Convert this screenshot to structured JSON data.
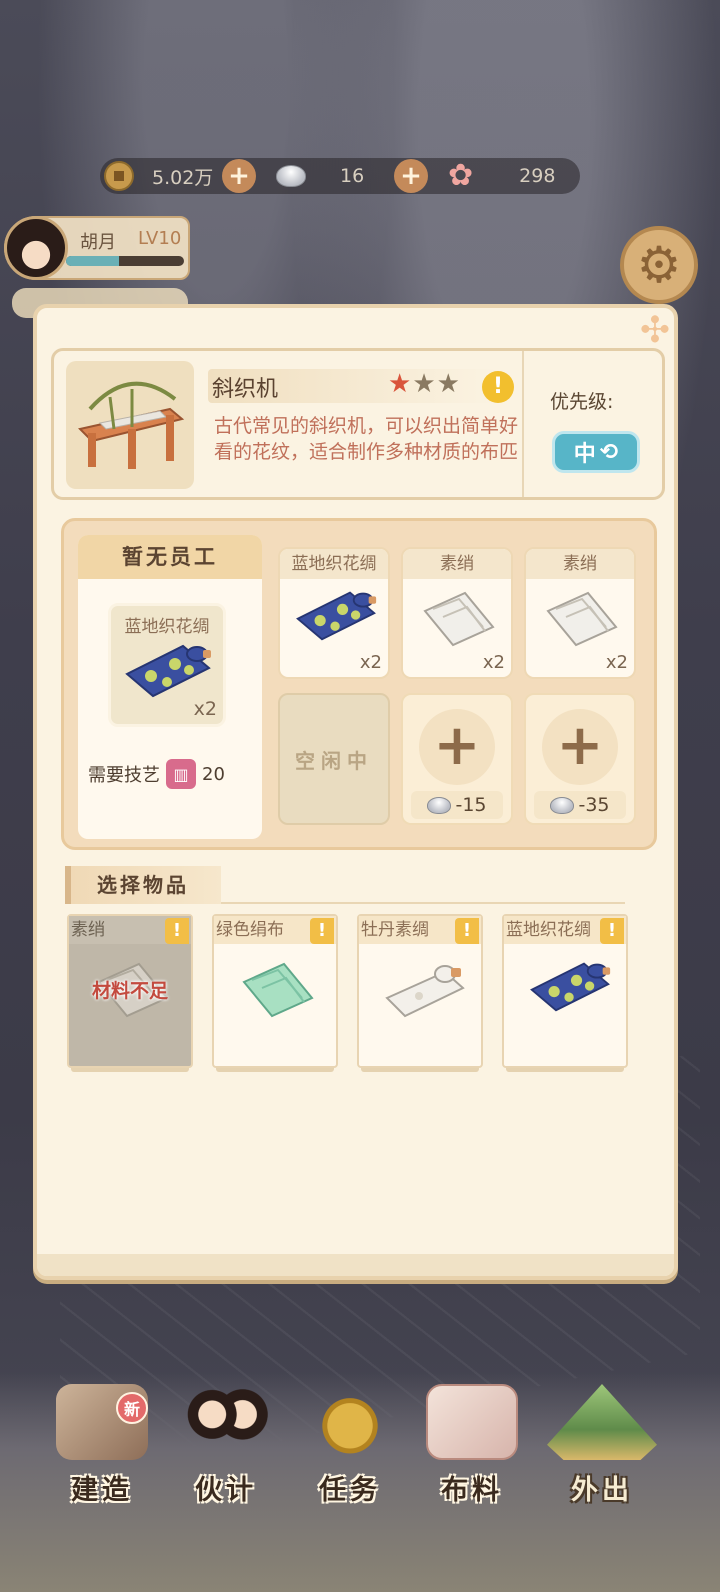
{
  "resources": {
    "coins": "5.02万",
    "silver": "16",
    "flowers": "298"
  },
  "player": {
    "name": "胡月",
    "level": "LV10",
    "xp_progress": 0.45
  },
  "machine": {
    "name": "斜织机",
    "stars_filled": 1,
    "stars_total": 3,
    "description": "古代常见的斜织机，可以织出简单好看的花纹，适合制作多种材质的布匹",
    "priority_label": "优先级:",
    "priority_value": "中"
  },
  "worker": {
    "header": "暂无员工",
    "item_name": "蓝地织花绸",
    "item_count": "x2",
    "skill_label": "需要技艺",
    "skill_value": "20"
  },
  "queue": {
    "slots": [
      {
        "name": "蓝地织花绸",
        "count": "x2"
      },
      {
        "name": "素绡",
        "count": "x2"
      },
      {
        "name": "素绡",
        "count": "x2"
      }
    ],
    "idle_label": "空闲中",
    "add_costs": [
      "-15",
      "-35"
    ]
  },
  "select": {
    "title": "选择物品",
    "insufficient_label": "材料不足",
    "items": [
      {
        "name": "素绡",
        "disabled": true
      },
      {
        "name": "绿色绢布",
        "disabled": false
      },
      {
        "name": "牡丹素绸",
        "disabled": false
      },
      {
        "name": "蓝地织花绸",
        "disabled": false
      }
    ]
  },
  "nav": {
    "new_badge": "新",
    "items": [
      {
        "label": "建造"
      },
      {
        "label": "伙计"
      },
      {
        "label": "任务"
      },
      {
        "label": "布料"
      },
      {
        "label": "外出"
      }
    ]
  },
  "colors": {
    "panel_bg": "#fbf3e2",
    "accent_teal": "#57b5c8",
    "star_on": "#d9543b",
    "warn_yellow": "#f2bf2e",
    "insufficient_red": "#c34a3e"
  }
}
